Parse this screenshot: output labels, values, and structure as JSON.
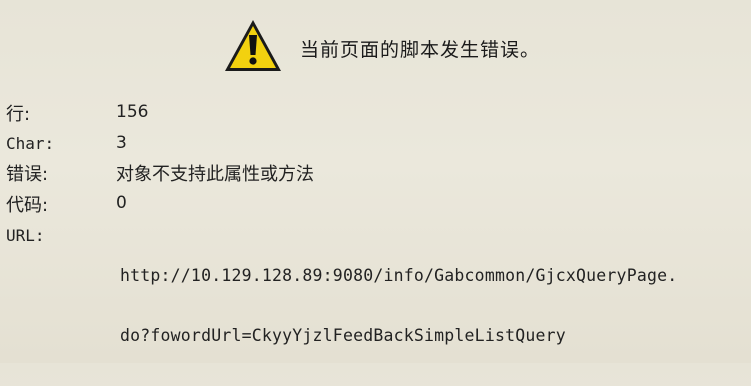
{
  "dialog": {
    "message": "当前页面的脚本发生错误。",
    "icon": "warning-icon",
    "accent_color": "#f2d10f"
  },
  "fields": {
    "line": {
      "label": "行:",
      "value": "156"
    },
    "char": {
      "label": "Char:",
      "value": "3"
    },
    "error": {
      "label": "错误:",
      "value": "对象不支持此属性或方法"
    },
    "code": {
      "label": "代码:",
      "value": "0"
    },
    "url": {
      "label": "URL:",
      "value_line1": "http://10.129.128.89:9080/info/Gabcommon/GjcxQueryPage.",
      "value_line2": "do?fowordUrl=CkyyYjzlFeedBackSimpleListQuery"
    }
  }
}
